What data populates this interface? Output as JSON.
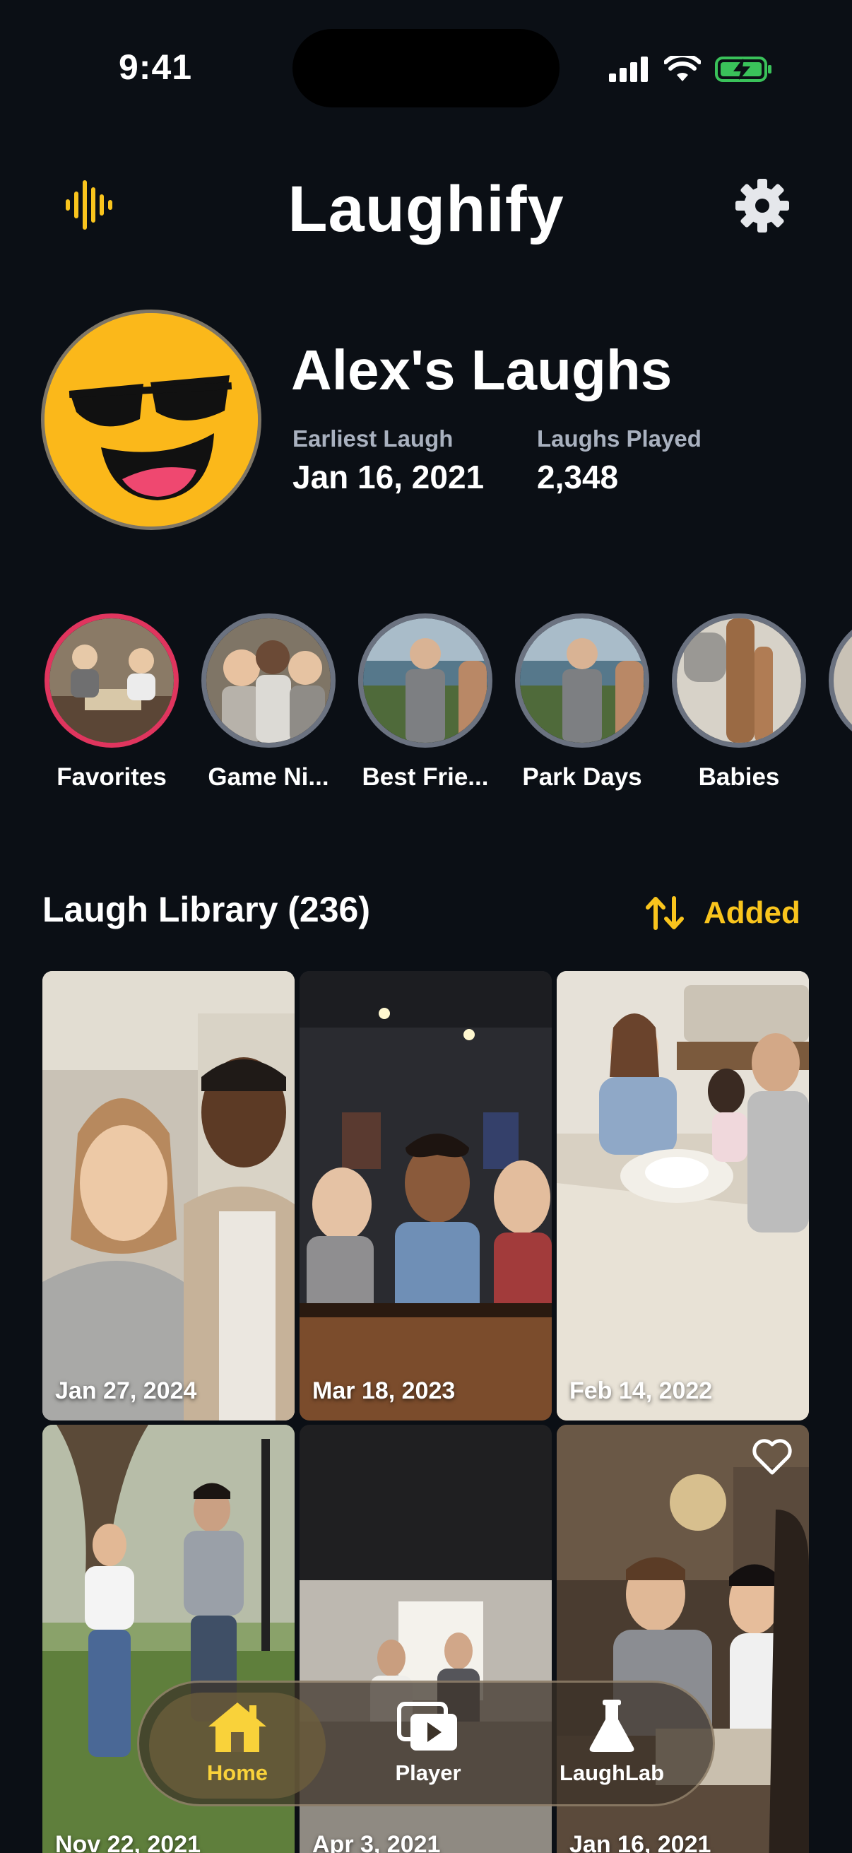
{
  "status": {
    "time": "9:41"
  },
  "header": {
    "title": "Laughify"
  },
  "profile": {
    "name": "Alex's Laughs",
    "stats": [
      {
        "label": "Earliest Laugh",
        "value": "Jan 16, 2021"
      },
      {
        "label": "Laughs Played",
        "value": "2,348"
      }
    ]
  },
  "albums": [
    {
      "label": "Favorites",
      "active": true
    },
    {
      "label": "Game Ni..."
    },
    {
      "label": "Best Frie..."
    },
    {
      "label": "Park Days"
    },
    {
      "label": "Babies"
    }
  ],
  "library": {
    "title": "Laugh Library (236)",
    "sort_label": "Added",
    "tiles": [
      {
        "date": "Jan 27, 2024"
      },
      {
        "date": "Mar 18, 2023"
      },
      {
        "date": "Feb 14, 2022"
      },
      {
        "date": "Nov 22, 2021"
      },
      {
        "date": "Apr 3, 2021"
      },
      {
        "date": "Jan 16, 2021"
      }
    ]
  },
  "tabs": [
    {
      "label": "Home",
      "icon": "home-icon",
      "active": true
    },
    {
      "label": "Player",
      "icon": "player-icon"
    },
    {
      "label": "LaughLab",
      "icon": "flask-icon"
    }
  ],
  "colors": {
    "accent": "#f9c41d",
    "background": "#0b0f15",
    "favorite_ring": "#e0355e"
  }
}
